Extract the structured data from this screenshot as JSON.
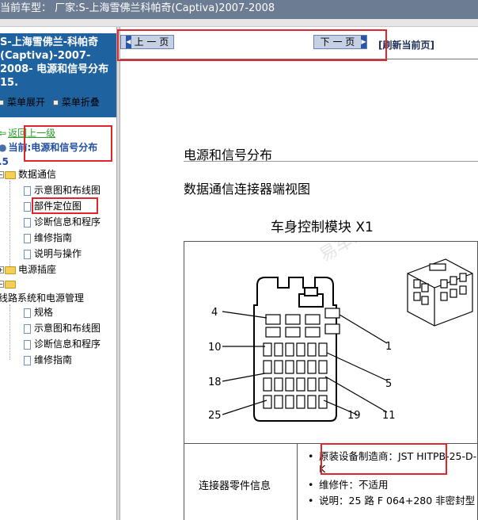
{
  "topbar": {
    "text": "当前车型：  厂家:S-上海雪佛兰科帕奇(Captiva)2007-2008"
  },
  "sidebar": {
    "header_lines": [
      "S-上海雪佛兰-科帕奇",
      "(Captiva)-2007-",
      "2008- 电源和信号分布",
      "15."
    ],
    "expand_label": "菜单展开",
    "collapse_label": "菜单折叠",
    "back_label": "返回上一级",
    "current_label": "当前:电源和信号分布",
    "current_suffix": ".5",
    "tree": {
      "data_comm": "数据通信",
      "data_comm_items": [
        "示意图和布线图",
        "部件定位图",
        "诊断信息和程序",
        "维修指南",
        "说明与操作"
      ],
      "power_socket": "电源插座",
      "wiring_mgmt": "线路系统和电源管理",
      "wiring_items": [
        "规格",
        "示意图和布线图",
        "诊断信息和程序",
        "维修指南"
      ]
    }
  },
  "nav": {
    "prev_label": "上 一 页",
    "next_label": "下 一 页",
    "refresh_label": "[刷新当前页]"
  },
  "content": {
    "section_title": "电源和信号分布",
    "subtitle": "数据通信连接器端视图",
    "module_title": "车身控制模块 X1",
    "pin_labels": {
      "p4": "4",
      "p10": "10",
      "p18": "18",
      "p25": "25",
      "p1": "1",
      "p5": "5",
      "p11": "11",
      "p19": "19"
    },
    "info_label": "连接器零件信息",
    "info_items": [
      "原装设备制造商：JST HITPB-25-D-K",
      "维修件：不适用",
      "说明：25 路 F 064+280 非密封型"
    ],
    "watermark": "易车.com 165"
  },
  "colors": {
    "topbar": "#6b7c93",
    "sidebar_header": "#1f62a0",
    "highlight": "#e0262a",
    "nav_button": "#c5d0e4"
  }
}
